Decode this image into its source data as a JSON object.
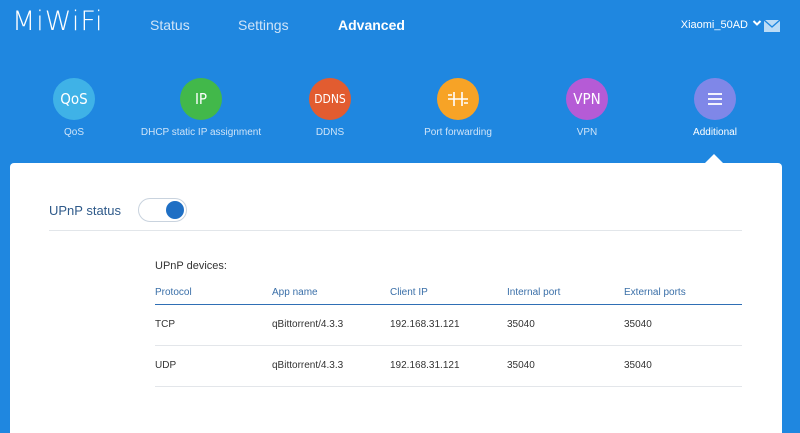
{
  "brand": "MiWiFi",
  "nav": [
    {
      "label": "Status",
      "active": false
    },
    {
      "label": "Settings",
      "active": false
    },
    {
      "label": "Advanced",
      "active": true
    }
  ],
  "router_name": "Xiaomi_50AD",
  "tools": [
    {
      "icon_text": "QoS",
      "label": "QoS",
      "color": "#3fb2e7"
    },
    {
      "icon_text": "IP",
      "label": "DHCP static IP assignment",
      "color": "#42b84a"
    },
    {
      "icon_text": "DDNS",
      "label": "DDNS",
      "color": "#e25c30"
    },
    {
      "icon_text": "",
      "icon": "port-forward-icon",
      "label": "Port forwarding",
      "color": "#f7a326"
    },
    {
      "icon_text": "VPN",
      "label": "VPN",
      "color": "#b55bd6"
    },
    {
      "icon_text": "",
      "icon": "menu-icon",
      "label": "Additional",
      "color": "#7f87e8",
      "active": true
    }
  ],
  "upnp": {
    "status_label": "UPnP status",
    "enabled": true,
    "devices_title": "UPnP devices:",
    "columns": [
      "Protocol",
      "App name",
      "Client IP",
      "Internal port",
      "External ports"
    ],
    "rows": [
      [
        "TCP",
        "qBittorrent/4.3.3",
        "192.168.31.121",
        "35040",
        "35040"
      ],
      [
        "UDP",
        "qBittorrent/4.3.3",
        "192.168.31.121",
        "35040",
        "35040"
      ]
    ]
  },
  "colors": {
    "header_bg": "#1f87e0",
    "accent": "#1f6fc4"
  }
}
